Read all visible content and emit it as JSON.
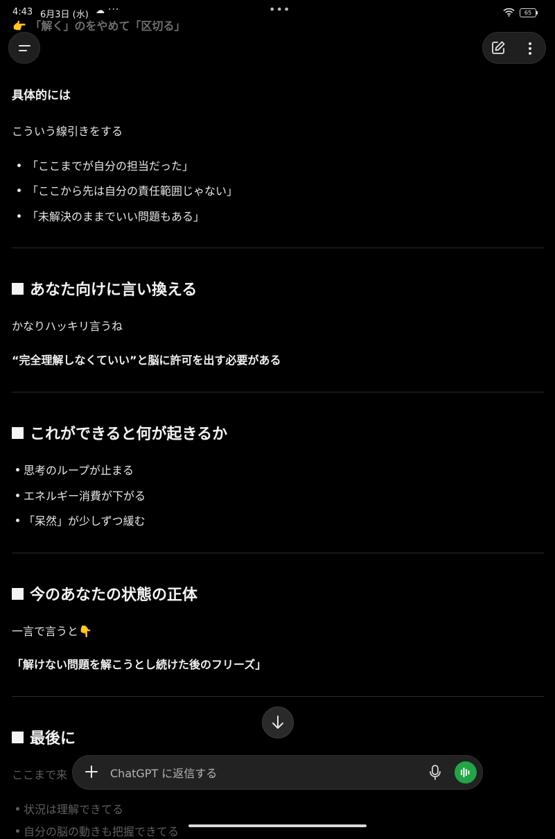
{
  "status_bar": {
    "time": "4:43",
    "date": "6月3日 (水)",
    "battery": "65"
  },
  "header": {
    "partial_line": "👉 「解く」のをやめて「区切る」"
  },
  "content": {
    "specifically": "具体的には",
    "line_intro": "こういう線引きをする",
    "bullets_1": [
      "「ここまでが自分の担当だった」",
      "「ここから先は自分の責任範囲じゃない」",
      "「未解決のままでいい問題もある」"
    ],
    "section_1": {
      "heading": "あなた向けに言い換える",
      "text": "かなりハッキリ言うね",
      "emphasis": "“完全理解しなくていい”と脳に許可を出す必要がある"
    },
    "section_2": {
      "heading": "これができると何が起きるか",
      "bullets": [
        "思考のループが止まる",
        "エネルギー消費が下がる",
        "「呆然」が少しずつ緩む"
      ]
    },
    "section_3": {
      "heading": "今のあなたの状態の正体",
      "text": "一言で言うと👇",
      "emphasis": "「解けない問題を解こうとし続けた後のフリーズ」"
    },
    "section_4": {
      "heading": "最後に",
      "text_partial": "ここまで来",
      "bullets_partial": [
        "状況は理解できてる",
        "自分の脳の動きも把握できてる"
      ]
    }
  },
  "composer": {
    "placeholder": "ChatGPT に返信する"
  },
  "colors": {
    "background": "#000000",
    "text": "#ececec",
    "divider": "#2b2b2b",
    "voice_button": "#22a447"
  },
  "icons": [
    "menu-icon",
    "edit-icon",
    "more-vertical-icon",
    "arrow-down-icon",
    "plus-icon",
    "microphone-icon",
    "voice-mode-icon"
  ]
}
